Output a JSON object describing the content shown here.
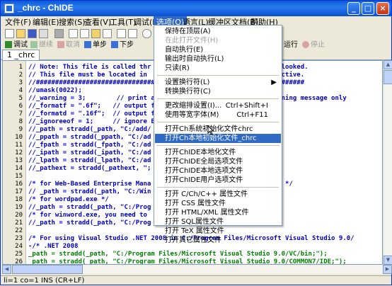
{
  "window": {
    "title": "_chrc - ChIDE"
  },
  "menubar": [
    "文件(F)",
    "编辑(E)",
    "搜索(S)",
    "查看(V)",
    "工具(T)",
    "调试(D)",
    "选项(O)",
    "语言(L)",
    "缓冲区文档(B)",
    "帮助(H)"
  ],
  "toolbar2": {
    "run": "调试",
    "continue": "继续",
    "abort": "取消",
    "step": "单步",
    "next": "下步",
    "run_label": "运行",
    "stop": "停止"
  },
  "tab": "1 _chrc",
  "code_lines": [
    {
      "n": "1",
      "t": "// Note: This file is called thr                                  looked.",
      "c": "com"
    },
    {
      "n": "2",
      "t": "// This file must be located in                               effective.",
      "c": "com"
    },
    {
      "n": "3",
      "t": "//######################################################################",
      "c": "com"
    },
    {
      "n": "4",
      "t": "//umask(0022);",
      "c": "com"
    },
    {
      "n": "5",
      "t": "//_warning = 3;        // print al                          us warning message only",
      "c": "com"
    },
    {
      "n": "6",
      "t": "//_formatf = \".6f\";   // output f",
      "c": "com"
    },
    {
      "n": "7",
      "t": "//_formatd = \".16f\";  // output f",
      "c": "com"
    },
    {
      "n": "8",
      "t": "//_ignoreeof = 1;     // ignore E",
      "c": "com"
    },
    {
      "n": "9",
      "t": "//_path = stradd(_path, \"C:/add/",
      "c": "com"
    },
    {
      "n": "10",
      "t": "//_ppath = stradd(_ppath, \"C:/ad",
      "c": "com"
    },
    {
      "n": "11",
      "t": "//_fpath = stradd(_fpath, \"C:/ad",
      "c": "com"
    },
    {
      "n": "12",
      "t": "//_ipath = stradd(_ipath, \"C:/ad",
      "c": "com"
    },
    {
      "n": "13",
      "t": "//_lpath = stradd(_lpath, \"C:/ad",
      "c": "com"
    },
    {
      "n": "14",
      "t": "//_pathext = stradd(_pathext, \";",
      "c": "com"
    },
    {
      "n": "15",
      "t": "",
      "c": "com"
    },
    {
      "n": "16",
      "t": "/* for Web-Based Enterprise Mana                              ator */",
      "c": "com"
    },
    {
      "n": "17",
      "t": "// _path = stradd(_path, \"C:/Win",
      "c": "com"
    },
    {
      "n": "18",
      "t": "/* for wordpad.exe */",
      "c": "com"
    },
    {
      "n": "19",
      "t": "//_path = stradd(_path, \"C:/Prog                         \");",
      "c": "com"
    },
    {
      "n": "20",
      "t": "/* for winword.exe, you need to                        ion 11 */",
      "c": "com"
    },
    {
      "n": "21",
      "t": "//_path = stradd(_path, \"C:/Prog                         1;\");",
      "c": "com"
    },
    {
      "n": "22",
      "t": "",
      "c": "com"
    },
    {
      "n": "23",
      "t": "/* For using Visual Studio .NET 2008 in C:/Program Files/Microsoft Visual Studio 9.0/",
      "c": "com"
    },
    {
      "n": "24",
      "t": "-/* .NET 2008",
      "c": "com"
    },
    {
      "n": "25",
      "t": "_path = stradd(_path, \"C:/Program Files/Microsoft Visual Studio 9.0/VC/bin;\");",
      "c": "code"
    },
    {
      "n": "26",
      "t": "_path = stradd(_path, \"C:/Program Files/Microsoft Visual Studio 9.0/COMMON7/IDE;\");",
      "c": "code"
    },
    {
      "n": "27",
      "t": "_path = stradd(_path, \"C:/Program Files/Microsoft SDKs/Windows/v6.0A/bin;\");",
      "c": "code"
    }
  ],
  "options_menu": [
    {
      "type": "item",
      "label": "保持在顶层(A)",
      "shortcut": "",
      "state": ""
    },
    {
      "type": "item",
      "label": "在此打开文件(H)",
      "shortcut": "",
      "state": "dis"
    },
    {
      "type": "item",
      "label": "自动执行(E)",
      "shortcut": "",
      "state": ""
    },
    {
      "type": "item",
      "label": "输出时自动执行(L)",
      "shortcut": "",
      "state": ""
    },
    {
      "type": "item",
      "label": "只读(R)",
      "shortcut": "",
      "state": ""
    },
    {
      "type": "sep"
    },
    {
      "type": "item",
      "label": "设置换行符(L)",
      "shortcut": "",
      "state": "",
      "arrow": "▶"
    },
    {
      "type": "item",
      "label": "转换换行符(C)",
      "shortcut": "",
      "state": ""
    },
    {
      "type": "sep"
    },
    {
      "type": "item",
      "label": "更改缩排设置(I)...",
      "shortcut": "Ctrl+Shift+I",
      "state": ""
    },
    {
      "type": "item",
      "label": "使用等宽字体(M)",
      "shortcut": "Ctrl+F11",
      "state": ""
    },
    {
      "type": "sep"
    },
    {
      "type": "item",
      "label": "打开Ch系统初始化文件chrc",
      "shortcut": "",
      "state": ""
    },
    {
      "type": "item",
      "label": "打开Ch本地初始化文件_chrc",
      "shortcut": "",
      "state": "hl"
    },
    {
      "type": "sep"
    },
    {
      "type": "item",
      "label": "打开ChIDE本地化文件",
      "shortcut": "",
      "state": ""
    },
    {
      "type": "item",
      "label": "打开ChIDE全局选项文件",
      "shortcut": "",
      "state": ""
    },
    {
      "type": "item",
      "label": "打开ChIDE本地选项文件",
      "shortcut": "",
      "state": ""
    },
    {
      "type": "item",
      "label": "打开ChIDE用户选项文件",
      "shortcut": "",
      "state": ""
    },
    {
      "type": "sep"
    },
    {
      "type": "item",
      "label": "打开 C/Ch/C++ 属性文件",
      "shortcut": "",
      "state": ""
    },
    {
      "type": "item",
      "label": "打开 CSS 属性文件",
      "shortcut": "",
      "state": ""
    },
    {
      "type": "item",
      "label": "打开 HTML/XML 属性文件",
      "shortcut": "",
      "state": ""
    },
    {
      "type": "item",
      "label": "打开 SQL属性文件",
      "shortcut": "",
      "state": ""
    },
    {
      "type": "item",
      "label": "打开 TeX 属性文件",
      "shortcut": "",
      "state": ""
    },
    {
      "type": "item",
      "label": "打开其它属性文件",
      "shortcut": "",
      "state": ""
    }
  ],
  "status": "li=1 co=1 INS (CR+LF)"
}
